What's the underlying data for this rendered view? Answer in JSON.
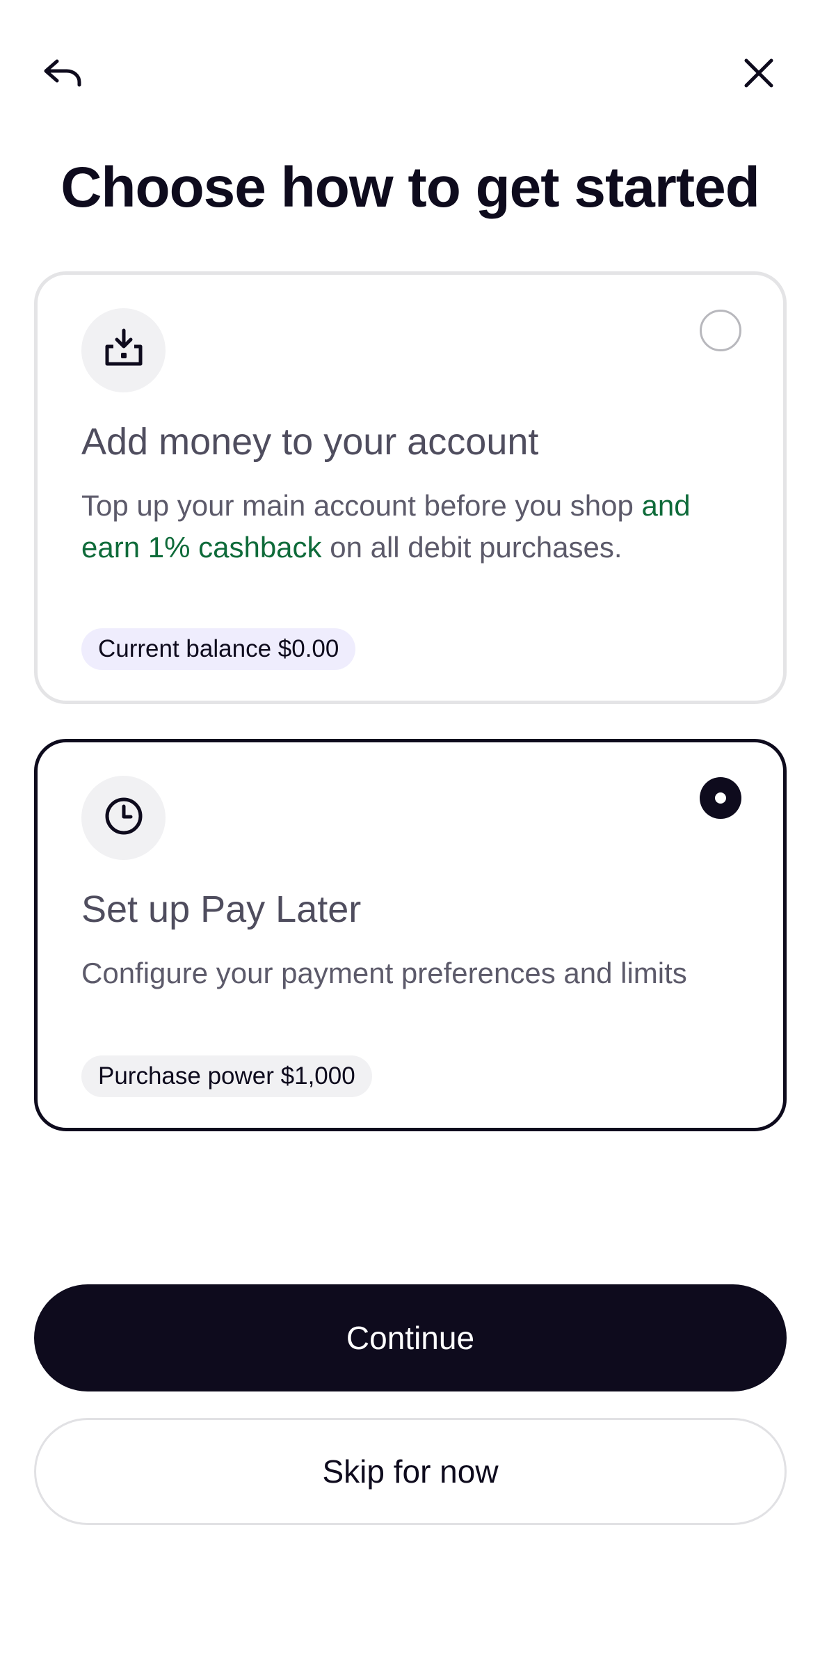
{
  "header": {
    "back_icon": "back-arrow-icon",
    "close_icon": "close-icon",
    "title": "Choose how to get started"
  },
  "options": [
    {
      "icon": "download-tray-icon",
      "title": "Add money to your account",
      "description_part1": "Top up your main account before you shop ",
      "description_highlight": "and earn 1% cashback",
      "description_part2": " on all debit purchases.",
      "badge": "Current balance $0.00",
      "selected": false
    },
    {
      "icon": "clock-icon",
      "title": "Set up Pay Later",
      "description": "Configure your payment preferences and limits",
      "badge": "Purchase power $1,000",
      "selected": true
    }
  ],
  "actions": {
    "continue_label": "Continue",
    "skip_label": "Skip for now"
  },
  "colors": {
    "primary": "#0e0b1d",
    "highlight_green": "#0f6b3a",
    "badge_purple": "#efedfd",
    "card_border": "#e4e4e6"
  }
}
